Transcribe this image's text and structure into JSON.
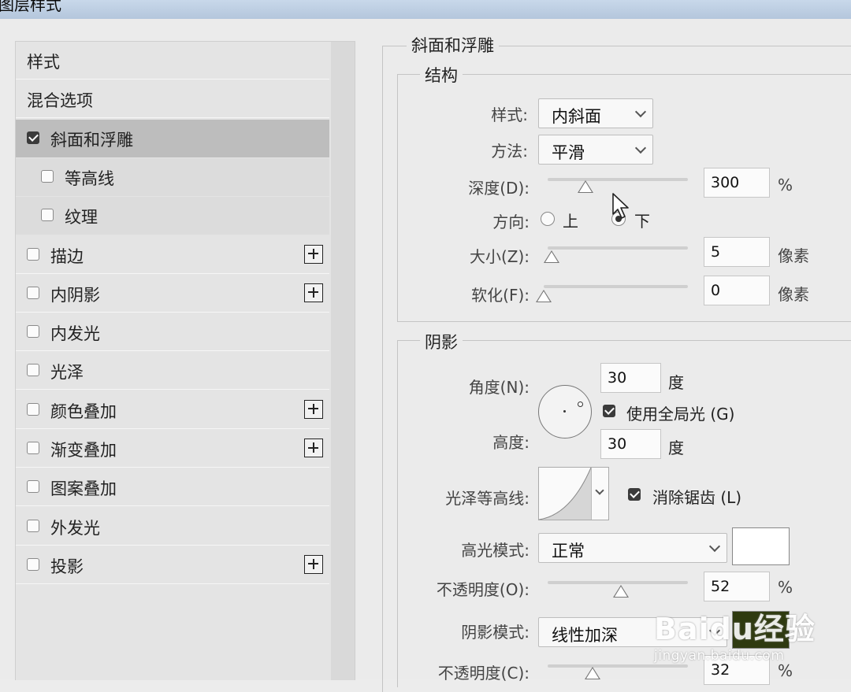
{
  "window": {
    "title": "图层样式"
  },
  "style_list": {
    "items": [
      {
        "label": "样式",
        "checkbox": false,
        "checked": false,
        "plus": false,
        "level": 0,
        "state": "normal"
      },
      {
        "label": "混合选项",
        "checkbox": false,
        "checked": false,
        "plus": false,
        "level": 0,
        "state": "normal"
      },
      {
        "label": "斜面和浮雕",
        "checkbox": true,
        "checked": true,
        "plus": false,
        "level": 0,
        "state": "selected"
      },
      {
        "label": "等高线",
        "checkbox": true,
        "checked": false,
        "plus": false,
        "level": 1,
        "state": "sub"
      },
      {
        "label": "纹理",
        "checkbox": true,
        "checked": false,
        "plus": false,
        "level": 1,
        "state": "sub"
      },
      {
        "label": "描边",
        "checkbox": true,
        "checked": false,
        "plus": true,
        "level": 0,
        "state": "normal"
      },
      {
        "label": "内阴影",
        "checkbox": true,
        "checked": false,
        "plus": true,
        "level": 0,
        "state": "normal"
      },
      {
        "label": "内发光",
        "checkbox": true,
        "checked": false,
        "plus": false,
        "level": 0,
        "state": "normal"
      },
      {
        "label": "光泽",
        "checkbox": true,
        "checked": false,
        "plus": false,
        "level": 0,
        "state": "normal"
      },
      {
        "label": "颜色叠加",
        "checkbox": true,
        "checked": false,
        "plus": true,
        "level": 0,
        "state": "normal"
      },
      {
        "label": "渐变叠加",
        "checkbox": true,
        "checked": false,
        "plus": true,
        "level": 0,
        "state": "normal"
      },
      {
        "label": "图案叠加",
        "checkbox": true,
        "checked": false,
        "plus": false,
        "level": 0,
        "state": "normal"
      },
      {
        "label": "外发光",
        "checkbox": true,
        "checked": false,
        "plus": false,
        "level": 0,
        "state": "normal"
      },
      {
        "label": "投影",
        "checkbox": true,
        "checked": false,
        "plus": true,
        "level": 0,
        "state": "normal"
      }
    ]
  },
  "bevel": {
    "title": "斜面和浮雕",
    "structure": {
      "title": "结构",
      "style_label": "样式:",
      "style_value": "内斜面",
      "technique_label": "方法:",
      "technique_value": "平滑",
      "depth_label": "深度(D):",
      "depth_value": "300",
      "depth_unit": "%",
      "depth_slider_fraction": 0.27,
      "direction_label": "方向:",
      "direction_up": "上",
      "direction_down": "下",
      "direction_selected": "down",
      "size_label": "大小(Z):",
      "size_value": "5",
      "size_unit": "像素",
      "size_slider_fraction": 0.03,
      "soften_label": "软化(F):",
      "soften_value": "0",
      "soften_unit": "像素",
      "soften_slider_fraction": 0.0
    },
    "shading": {
      "title": "阴影",
      "angle_label": "角度(N):",
      "angle_value": "30",
      "angle_unit": "度",
      "global_light_label": "使用全局光 (G)",
      "global_light_checked": true,
      "altitude_label": "高度:",
      "altitude_value": "30",
      "altitude_unit": "度",
      "gloss_contour_label": "光泽等高线:",
      "anti_alias_label": "消除锯齿 (L)",
      "anti_alias_checked": true,
      "highlight_mode_label": "高光模式:",
      "highlight_mode_value": "正常",
      "highlight_color": "#ffffff",
      "highlight_opacity_label": "不透明度(O):",
      "highlight_opacity_value": "52",
      "highlight_opacity_unit": "%",
      "highlight_opacity_fraction": 0.52,
      "shadow_mode_label": "阴影模式:",
      "shadow_mode_value": "线性加深",
      "shadow_color": "#2f3a10",
      "shadow_opacity_label": "不透明度(C):",
      "shadow_opacity_value": "32",
      "shadow_opacity_unit": "%",
      "shadow_opacity_fraction": 0.32
    }
  },
  "watermark": {
    "brand": "Baidu经验",
    "url": "jingyan.baidu.com"
  }
}
